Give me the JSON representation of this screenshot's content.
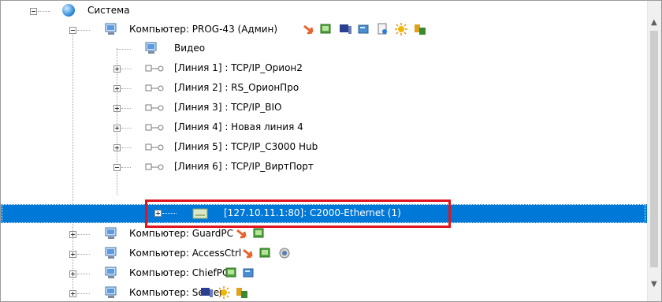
{
  "tree": {
    "root_label": "Система",
    "computer_prog": {
      "label": "Компьютер: PROG-43 (Админ)",
      "status_icons": [
        "arrow-icon",
        "monitor-icon",
        "workstation-icon",
        "card-icon",
        "document-icon",
        "sun-icon",
        "db-icon"
      ]
    },
    "video_label": "Видео",
    "lines": [
      "[Линия 1] : TCP/IP_Орион2",
      "[Линия 2] : RS_ОрионПро",
      "[Линия 3] : TCP/IP_BIO",
      "[Линия 4] : Новая линия 4",
      "[Линия 5] : TCP/IP_C3000 Hub",
      "[Линия 6] : TCP/IP_ВиртПорт"
    ],
    "selected_device": "[127.10.11.1:80]: C2000-Ethernet (1)",
    "computers": [
      "Компьютер: GuardPC",
      "Компьютер: AccessCtrl",
      "Компьютер: ChiefPC",
      "Компьютер: Server"
    ]
  },
  "colors": {
    "selection": "#0078d7",
    "highlight_box": "#e0141e"
  }
}
